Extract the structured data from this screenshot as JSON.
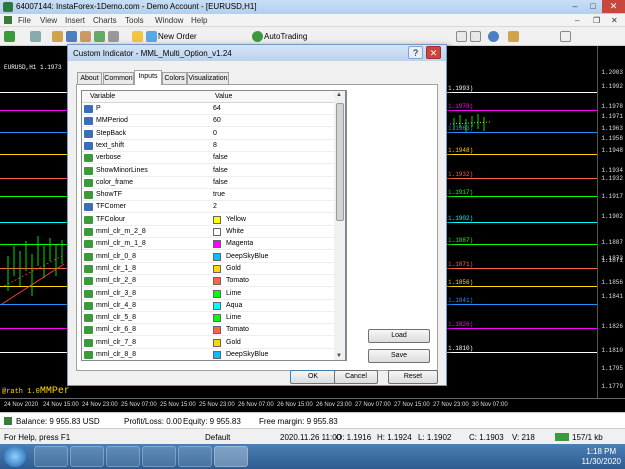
{
  "window": {
    "title": "64007144: InstaForex-1Demo.com - Demo Account - [EURUSD,H1]",
    "controls": [
      "–",
      "□",
      "✕"
    ]
  },
  "menu": [
    "File",
    "View",
    "Insert",
    "Charts",
    "Tools",
    "Window",
    "Help"
  ],
  "toolbar": {
    "new_order": "New Order",
    "autotrading": "AutoTrading"
  },
  "chart": {
    "symbol_label": "EURUSD,H1  1.1973",
    "bottom_text": "@rath 1.0",
    "bottom_text_large": "MMPer",
    "price_ticks": [
      "1.2003",
      "1.1992",
      "1.1978",
      "1.1971",
      "1.1963",
      "1.1958",
      "1.1948",
      "1.1934",
      "1.1932",
      "1.1917",
      "1.1902",
      "1.1887",
      "1.1873",
      "1.1871",
      "1.1856",
      "1.1841",
      "1.1826",
      "1.1810",
      "1.1795",
      "1.1779"
    ],
    "levels": [
      {
        "label": "1.1993)",
        "color": "#ffffff"
      },
      {
        "label": "1.1978)",
        "color": "#ff00ff"
      },
      {
        "label": "1.1963)",
        "color": "#1e90ff"
      },
      {
        "label": "1.1948)",
        "color": "#ffd700"
      },
      {
        "label": "1.1932)",
        "color": "#ff6347"
      },
      {
        "label": "1.1917)",
        "color": "#00ff00"
      },
      {
        "label": "1.1902)",
        "color": "#00ffff"
      },
      {
        "label": "1.1887)",
        "color": "#00ff00"
      },
      {
        "label": "1.1871)",
        "color": "#ff6347"
      },
      {
        "label": "1.1856)",
        "color": "#ffd700"
      },
      {
        "label": "1.1841)",
        "color": "#1e90ff"
      },
      {
        "label": "1.1826)",
        "color": "#ff00ff"
      },
      {
        "label": "1.1810)",
        "color": "#ffffff"
      }
    ],
    "time_labels": [
      "24 Nov 2020",
      "24 Nov 15:00",
      "24 Nov 23:00",
      "25 Nov 07:00",
      "25 Nov 15:00",
      "25 Nov 23:00",
      "26 Nov 07:00",
      "26 Nov 15:00",
      "26 Nov 23:00",
      "27 Nov 07:00",
      "27 Nov 15:00",
      "27 Nov 23:00",
      "30 Nov 07:00"
    ]
  },
  "account": {
    "balance": "Balance: 9 955.83 USD",
    "profit": "Profit/Loss: 0.00",
    "equity": "Equity: 9 955.83",
    "free_margin": "Free margin: 9 955.83"
  },
  "status": {
    "help": "For Help, press F1",
    "profile": "Default",
    "datetime": "2020.11.26 11:00",
    "open": "O: 1.1916",
    "high": "H: 1.1924",
    "low": "L: 1.1902",
    "close": "C: 1.1903",
    "volume": "V: 218",
    "traffic": "157/1 kb"
  },
  "taskbar": {
    "time": "1:18 PM",
    "date": "11/30/2020"
  },
  "dialog": {
    "title": "Custom Indicator - MML_Multi_Option_v1.24",
    "tabs": [
      "About",
      "Common",
      "Inputs",
      "Colors",
      "Visualization"
    ],
    "active_tab": "Inputs",
    "col_variable": "Variable",
    "col_value": "Value",
    "rows": [
      {
        "name": "P",
        "value": "64",
        "type": "int"
      },
      {
        "name": "MMPeriod",
        "value": "60",
        "type": "int"
      },
      {
        "name": "StepBack",
        "value": "0",
        "type": "int"
      },
      {
        "name": "text_shift",
        "value": "8",
        "type": "int"
      },
      {
        "name": "verbose",
        "value": "false",
        "type": "bool"
      },
      {
        "name": "ShowMinorLines",
        "value": "false",
        "type": "bool"
      },
      {
        "name": "color_frame",
        "value": "false",
        "type": "bool"
      },
      {
        "name": "ShowTF",
        "value": "true",
        "type": "bool"
      },
      {
        "name": "TFCorner",
        "value": "2",
        "type": "int"
      },
      {
        "name": "TFColour",
        "value": "Yellow",
        "type": "color",
        "swatch": "#ffff00"
      },
      {
        "name": "mml_clr_m_2_8",
        "value": "White",
        "type": "color",
        "swatch": "#ffffff"
      },
      {
        "name": "mml_clr_m_1_8",
        "value": "Magenta",
        "type": "color",
        "swatch": "#ff00ff"
      },
      {
        "name": "mml_clr_0_8",
        "value": "DeepSkyBlue",
        "type": "color",
        "swatch": "#00bfff"
      },
      {
        "name": "mml_clr_1_8",
        "value": "Gold",
        "type": "color",
        "swatch": "#ffd700"
      },
      {
        "name": "mml_clr_2_8",
        "value": "Tomato",
        "type": "color",
        "swatch": "#ff6347"
      },
      {
        "name": "mml_clr_3_8",
        "value": "Lime",
        "type": "color",
        "swatch": "#00ff00"
      },
      {
        "name": "mml_clr_4_8",
        "value": "Aqua",
        "type": "color",
        "swatch": "#00ffff"
      },
      {
        "name": "mml_clr_5_8",
        "value": "Lime",
        "type": "color",
        "swatch": "#00ff00"
      },
      {
        "name": "mml_clr_6_8",
        "value": "Tomato",
        "type": "color",
        "swatch": "#ff6347"
      },
      {
        "name": "mml_clr_7_8",
        "value": "Gold",
        "type": "color",
        "swatch": "#ffd700"
      },
      {
        "name": "mml_clr_8_8",
        "value": "DeepSkyBlue",
        "type": "color",
        "swatch": "#00bfff"
      }
    ],
    "load_button": "Load",
    "save_button": "Save",
    "ok_button": "OK",
    "cancel_button": "Cancel",
    "reset_button": "Reset"
  }
}
